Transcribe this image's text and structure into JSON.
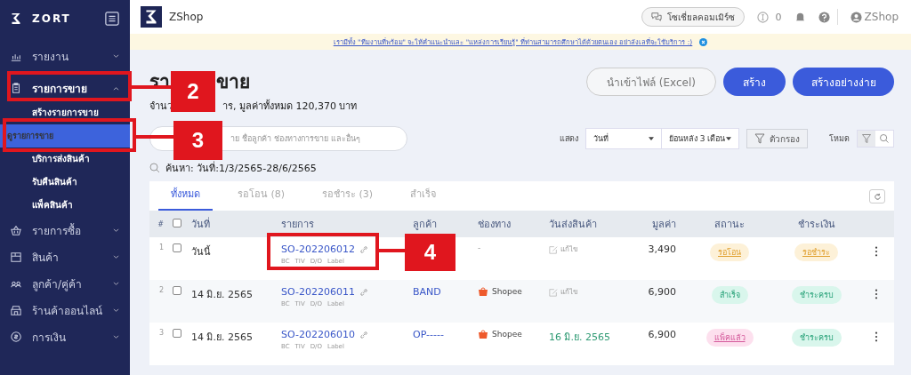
{
  "sidebar": {
    "brand": "ZORT",
    "items": [
      {
        "label": "รายงาน",
        "expanded": false
      },
      {
        "label": "รายการขาย",
        "expanded": true,
        "children": [
          {
            "label": "สร้างรายการขาย",
            "selected": false
          },
          {
            "label": "ดูรายการขาย",
            "selected": true
          },
          {
            "label": "บริการส่งสินค้า",
            "selected": false
          },
          {
            "label": "รับคืนสินค้า",
            "selected": false
          },
          {
            "label": "แพ็คสินค้า",
            "selected": false
          }
        ]
      },
      {
        "label": "รายการซื้อ",
        "expanded": false
      },
      {
        "label": "สินค้า",
        "expanded": false
      },
      {
        "label": "ลูกค้า/คู่ค้า",
        "expanded": false
      },
      {
        "label": "ร้านค้าออนไลน์",
        "expanded": false
      },
      {
        "label": "การเงิน",
        "expanded": false
      }
    ]
  },
  "topbar": {
    "shop": "ZShop",
    "social_button": "โซเชี่ยลคอมเมิร์ซ",
    "credits": "0",
    "user": "ZShop"
  },
  "banner": "เรามีทั้ง \"ทีมงานที่พร้อม\" จะให้คำแนะนำและ \"แหล่งการเรียนรู้\" ที่ท่านสามารถศึกษาได้ด้วยตนเอง อย่าลังเลที่จะใช้บริการ :)",
  "title_parts": [
    "รา",
    "ขาย"
  ],
  "summary_parts": [
    "จำนว",
    "าร, มูลค่าทั้งหมด 120,370 บาท"
  ],
  "buttons": {
    "import": "นำเข้าไฟล์ (Excel)",
    "create": "สร้าง",
    "quick_create": "สร้างอย่างง่าย"
  },
  "search": {
    "placeholder": "าย ชื่อลูกค้า ช่องทางการขาย และอื่นๆ"
  },
  "filters": {
    "show_label": "แสดง",
    "date_field": "วันที่",
    "range": "ย้อนหลัง 3 เดือน",
    "filter_button": "ตัวกรอง",
    "mode_label": "โหมด"
  },
  "query": "ค้นหา: วันที่:1/3/2565-28/6/2565",
  "tabs": [
    {
      "label": "ทั้งหมด",
      "selected": true
    },
    {
      "label": "รอโอน (8)",
      "selected": false
    },
    {
      "label": "รอชำระ (3)",
      "selected": false
    },
    {
      "label": "สำเร็จ",
      "selected": false
    }
  ],
  "table": {
    "columns": [
      "#",
      "วันที่",
      "รายการ",
      "ลูกค้า",
      "ช่องทาง",
      "วันส่งสินค้า",
      "มูลค่า",
      "สถานะ",
      "ชำระเงิน"
    ],
    "all_checked": false,
    "rows": [
      {
        "num": "1",
        "checked": false,
        "date": "วันนี้",
        "order": "SO-202206012",
        "tags": [
          "BC",
          "TIV",
          "D/O",
          "Label"
        ],
        "channel": {
          "kind": "none",
          "label": "-"
        },
        "ship": {
          "kind": "edit",
          "label": "แก้ไข"
        },
        "value": "3,490",
        "status": {
          "kind": "pending",
          "label": "รอโอน"
        },
        "payment": {
          "kind": "pending",
          "label": "รอชำระ"
        }
      },
      {
        "num": "2",
        "checked": false,
        "date": "14 มิ.ย. 2565",
        "order": "SO-202206011",
        "tags": [
          "BC",
          "TIV",
          "D/O",
          "Label"
        ],
        "customer": "BAND",
        "channel": {
          "kind": "shopee",
          "label": "Shopee"
        },
        "ship": {
          "kind": "edit",
          "label": "แก้ไข"
        },
        "value": "6,900",
        "status": {
          "kind": "done",
          "label": "สำเร็จ"
        },
        "payment": {
          "kind": "done",
          "label": "ชำระครบ"
        }
      },
      {
        "num": "3",
        "checked": false,
        "date": "14 มิ.ย. 2565",
        "order": "SO-202206010",
        "tags": [
          "BC",
          "TIV",
          "D/O",
          "Label"
        ],
        "customer": "OP-----",
        "channel": {
          "kind": "shopee",
          "label": "Shopee"
        },
        "ship": {
          "kind": "date",
          "label": "16 มิ.ย. 2565"
        },
        "value": "6,900",
        "status": {
          "kind": "packed",
          "label": "แพ็คแล้ว"
        },
        "payment": {
          "kind": "done",
          "label": "ชำระครบ"
        }
      }
    ]
  },
  "callouts": [
    {
      "label": "2",
      "kind": "menu"
    },
    {
      "label": "3",
      "kind": "submenu"
    },
    {
      "label": "4",
      "kind": "order"
    }
  ]
}
